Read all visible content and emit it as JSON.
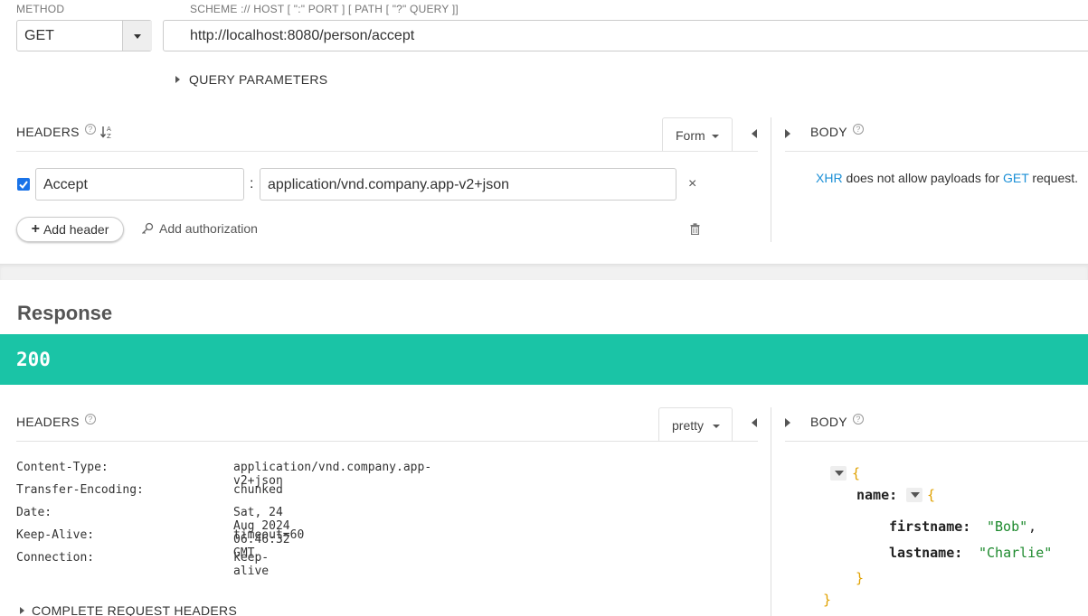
{
  "request": {
    "method_label": "METHOD",
    "method_value": "GET",
    "url_label": "SCHEME :// HOST [ \":\" PORT ] [ PATH [ \"?\" QUERY ]]",
    "url_value": "http://localhost:8080/person/accept",
    "query_params_label": "QUERY PARAMETERS",
    "headers_title": "HEADERS",
    "headers_mode": "Form",
    "header_row": {
      "checked": true,
      "name": "Accept",
      "separator": ":",
      "value": "application/vnd.company.app-v2+json"
    },
    "add_header_label": "Add header",
    "add_auth_label": "Add authorization",
    "body_title": "BODY",
    "body_msg": {
      "part1": "XHR",
      "part2": " does not allow payloads for ",
      "part3": "GET",
      "part4": " request."
    }
  },
  "response": {
    "title": "Response",
    "status": "200",
    "status_color": "#1ac4a6",
    "headers_title": "HEADERS",
    "headers_mode": "pretty",
    "headers": [
      {
        "name": "Content-Type:",
        "value": "application/vnd.company.app-v2+json"
      },
      {
        "name": "Transfer-Encoding:",
        "value": "chunked"
      },
      {
        "name": "Date:",
        "value": "Sat, 24 Aug 2024 06:46:32 GMT"
      },
      {
        "name": "Keep-Alive:",
        "value": "timeout=60"
      },
      {
        "name": "Connection:",
        "value": "keep-alive"
      }
    ],
    "complete_headers_label": "COMPLETE REQUEST HEADERS",
    "body_title": "BODY",
    "json": {
      "open_brace": "{",
      "name_key": "name:",
      "name_open": "{",
      "firstname_key": "firstname:",
      "firstname_value": "\"Bob\"",
      "comma": ",",
      "lastname_key": "lastname:",
      "lastname_value": "\"Charlie\"",
      "name_close": "}",
      "close_brace": "}"
    }
  },
  "icons": {
    "help": "?",
    "sort": "sort-az-icon",
    "close": "×",
    "trash": "trash-icon",
    "key": "key-icon",
    "plus": "+"
  }
}
